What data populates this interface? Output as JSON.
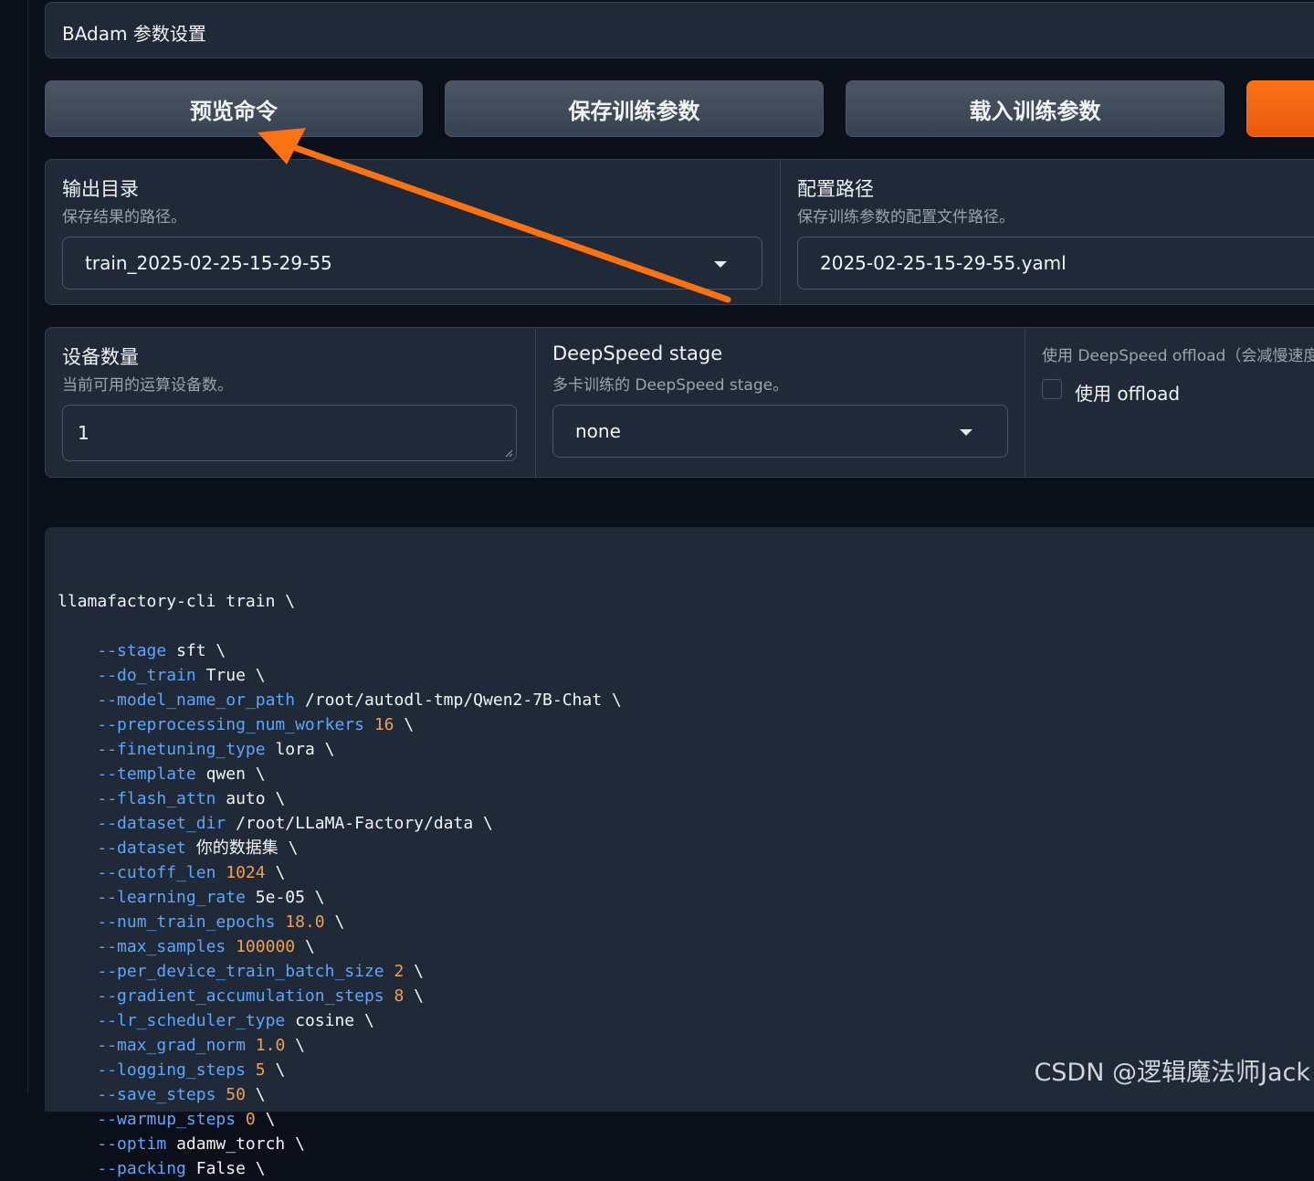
{
  "accordion": {
    "title": "BAdam 参数设置"
  },
  "buttons": {
    "preview": "预览命令",
    "save": "保存训练参数",
    "load": "载入训练参数",
    "start": ""
  },
  "output_dir": {
    "label": "输出目录",
    "info": "保存结果的路径。",
    "value": "train_2025-02-25-15-29-55"
  },
  "config_path": {
    "label": "配置路径",
    "info": "保存训练参数的配置文件路径。",
    "value": "2025-02-25-15-29-55.yaml"
  },
  "device_count": {
    "label": "设备数量",
    "info": "当前可用的运算设备数。",
    "value": "1"
  },
  "ds_stage": {
    "label": "DeepSpeed stage",
    "info": "多卡训练的 DeepSpeed stage。",
    "value": "none"
  },
  "ds_offload": {
    "label": "使用 DeepSpeed offload（会减慢速度）",
    "checkbox_label": "使用 offload",
    "checked": false
  },
  "command": {
    "first_line": "llamafactory-cli train \\",
    "lines": [
      {
        "flag": "--stage",
        "value": "sft",
        "numeric": false
      },
      {
        "flag": "--do_train",
        "value": "True",
        "numeric": false
      },
      {
        "flag": "--model_name_or_path",
        "value": "/root/autodl-tmp/Qwen2-7B-Chat",
        "numeric": false
      },
      {
        "flag": "--preprocessing_num_workers",
        "value": "16",
        "numeric": true
      },
      {
        "flag": "--finetuning_type",
        "value": "lora",
        "numeric": false
      },
      {
        "flag": "--template",
        "value": "qwen",
        "numeric": false
      },
      {
        "flag": "--flash_attn",
        "value": "auto",
        "numeric": false
      },
      {
        "flag": "--dataset_dir",
        "value": "/root/LLaMA-Factory/data",
        "numeric": false
      },
      {
        "flag": "--dataset",
        "value": "你的数据集",
        "numeric": false
      },
      {
        "flag": "--cutoff_len",
        "value": "1024",
        "numeric": true
      },
      {
        "flag": "--learning_rate",
        "value": "5e-05",
        "numeric": false
      },
      {
        "flag": "--num_train_epochs",
        "value": "18.0",
        "numeric": true
      },
      {
        "flag": "--max_samples",
        "value": "100000",
        "numeric": true
      },
      {
        "flag": "--per_device_train_batch_size",
        "value": "2",
        "numeric": true
      },
      {
        "flag": "--gradient_accumulation_steps",
        "value": "8",
        "numeric": true
      },
      {
        "flag": "--lr_scheduler_type",
        "value": "cosine",
        "numeric": false
      },
      {
        "flag": "--max_grad_norm",
        "value": "1.0",
        "numeric": true
      },
      {
        "flag": "--logging_steps",
        "value": "5",
        "numeric": true
      },
      {
        "flag": "--save_steps",
        "value": "50",
        "numeric": true
      },
      {
        "flag": "--warmup_steps",
        "value": "0",
        "numeric": true
      },
      {
        "flag": "--optim",
        "value": "adamw_torch",
        "numeric": false
      },
      {
        "flag": "--packing",
        "value": "False",
        "numeric": false
      }
    ]
  },
  "watermark": "CSDN @逻辑魔法师Jack",
  "colors": {
    "accent": "#f97316",
    "flag": "#60a5fa",
    "number": "#f0a050",
    "panel": "#1f2937"
  }
}
